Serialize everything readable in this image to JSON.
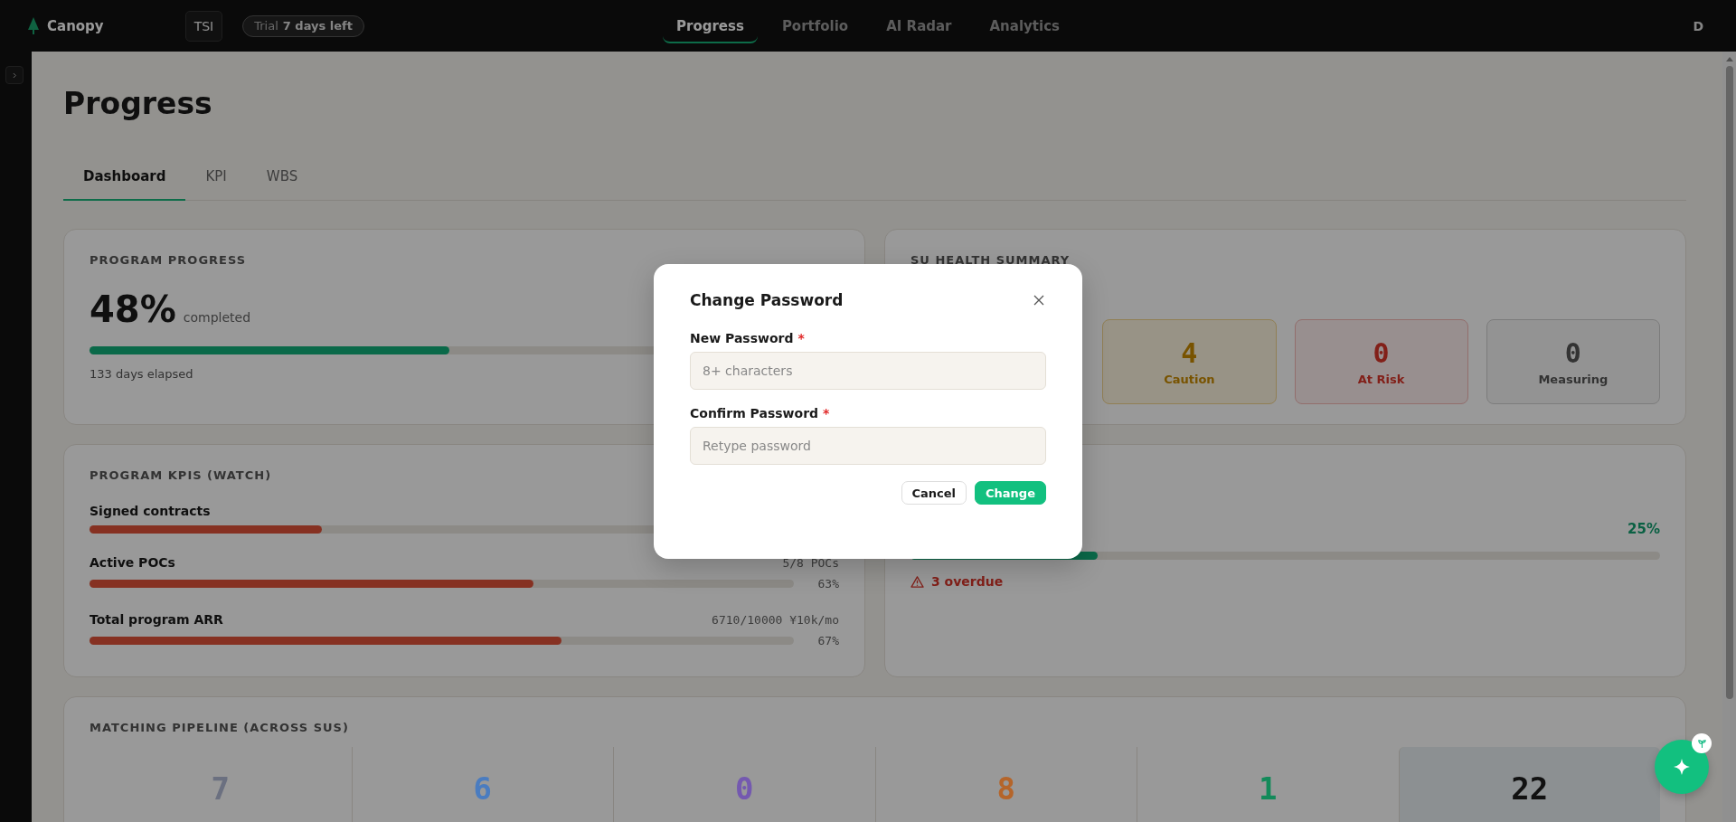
{
  "app": {
    "logo": "Canopy",
    "workspace": "TSI",
    "trial": {
      "label": "Trial",
      "remaining": "7 days left"
    },
    "nav": [
      {
        "label": "Progress",
        "selected": true
      },
      {
        "label": "Portfolio",
        "selected": false
      },
      {
        "label": "AI Radar",
        "selected": false
      },
      {
        "label": "Analytics",
        "selected": false
      }
    ],
    "user": "D"
  },
  "page": {
    "title": "Progress",
    "tabs": [
      {
        "label": "Dashboard",
        "selected": true
      },
      {
        "label": "KPI",
        "selected": false
      },
      {
        "label": "WBS",
        "selected": false
      }
    ]
  },
  "program_progress": {
    "title": "PROGRAM PROGRESS",
    "percent": "48%",
    "suffix": "completed",
    "level": 0.48,
    "caption": "133 days elapsed"
  },
  "health_summary": {
    "title": "SU HEALTH SUMMARY",
    "tiles": [
      {
        "kind": "caution",
        "count": "4",
        "label": "Caution"
      },
      {
        "kind": "risk",
        "count": "0",
        "label": "At Risk"
      },
      {
        "kind": "measuring",
        "count": "0",
        "label": "Measuring"
      }
    ]
  },
  "kpis": {
    "title": "PROGRAM KPIS (WATCH)",
    "items": [
      {
        "name": "Signed contracts",
        "level": 0.33
      },
      {
        "name": "Active POCs",
        "reading": "5/8 POCs",
        "percent": "63%",
        "level": 0.63
      },
      {
        "name": "Total program ARR",
        "reading": "6710/10000 ¥10k/mo",
        "percent": "67%",
        "level": 0.67
      }
    ]
  },
  "milestones": {
    "percent": "25%",
    "level": 0.25,
    "overdue": "3 overdue"
  },
  "pipeline": {
    "title": "MATCHING PIPELINE (ACROSS SUS)",
    "stages": [
      {
        "value": "7",
        "color": "#6b7080",
        "highlighted": false
      },
      {
        "value": "6",
        "color": "#4a7cc0",
        "highlighted": false
      },
      {
        "value": "0",
        "color": "#7459b0",
        "highlighted": false
      },
      {
        "value": "8",
        "color": "#b5652a",
        "highlighted": false
      },
      {
        "value": "1",
        "color": "#138a5a",
        "highlighted": false
      },
      {
        "value": "22",
        "color": "#111111",
        "highlighted": true
      }
    ]
  },
  "dialog": {
    "title": "Change Password",
    "fields": [
      {
        "label": "New Password",
        "required_mark": "*",
        "placeholder": "8+ characters"
      },
      {
        "label": "Confirm Password",
        "required_mark": "*",
        "placeholder": "Retype password"
      }
    ],
    "buttons": [
      {
        "label": "Cancel",
        "kind": "secondary"
      },
      {
        "label": "Change",
        "kind": "primary"
      }
    ]
  }
}
